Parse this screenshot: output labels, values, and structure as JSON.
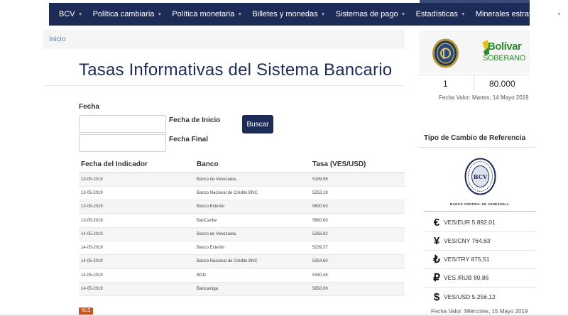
{
  "nav": {
    "items": [
      {
        "label": "BCV"
      },
      {
        "label": "Política cambiaria"
      },
      {
        "label": "Política monetaria"
      },
      {
        "label": "Billetes y monedas"
      },
      {
        "label": "Sistemas de pago"
      },
      {
        "label": "Estadísticas"
      },
      {
        "label": "Minerales estratégicos"
      }
    ]
  },
  "breadcrumb": {
    "home": "Inicio"
  },
  "page": {
    "title": "Tasas Informativas del Sistema Bancario"
  },
  "form": {
    "fecha_label": "Fecha",
    "start_label": "Fecha de Inicio",
    "end_label": "Fecha Final",
    "start_value": "",
    "end_value": "",
    "search_button": "Buscar"
  },
  "table": {
    "headers": [
      "Fecha del Indicador",
      "Banco",
      "Tasa (VES/USD)"
    ],
    "rows": [
      [
        "13-05-2019",
        "Banco de Venezuela",
        "5189.56"
      ],
      [
        "13-05-2019",
        "Banco Nacional de Crédito BNC",
        "5253.19"
      ],
      [
        "13-05-2019",
        "Banco Exterior",
        "5600.00"
      ],
      [
        "13-05-2019",
        "BanCaribe",
        "5860.00"
      ],
      [
        "14-05-2019",
        "Banco de Venezuela",
        "5256.82"
      ],
      [
        "14-05-2019",
        "Banco Exterior",
        "5239.37"
      ],
      [
        "14-05-2019",
        "Banco Nacional de Crédito BNC",
        "5254.60"
      ],
      [
        "14-05-2019",
        "BOD",
        "5340.45"
      ],
      [
        "14-05-2019",
        "Bancamiga",
        "5650.00"
      ]
    ],
    "export_label": "XLS"
  },
  "sidebar": {
    "bolivar_logo": {
      "line1": "Bolívar",
      "line2": "SOBERANO"
    },
    "petro_value": "1",
    "bs_value": "80.000",
    "petro_fecha": "Fecha Valor: Martes, 14 Mayo 2019",
    "ref_heading": "Tipo de Cambio de Referencia",
    "seal_caption": "BANCO CENTRAL DE VENEZUELA",
    "seal_initials": "BCV",
    "rates": [
      {
        "symbol": "€",
        "icon": "euro-icon",
        "text": "VES/EUR 5.892,01"
      },
      {
        "symbol": "¥",
        "icon": "yuan-icon",
        "text": "VES/CNY 764,63"
      },
      {
        "symbol": "₺",
        "icon": "lira-icon",
        "text": "VES/TRY 875,51"
      },
      {
        "symbol": "₽",
        "icon": "ruble-icon",
        "text": "VES /RUB 80,86"
      },
      {
        "symbol": "$",
        "icon": "dollar-icon",
        "text": "VES/USD 5.256,12"
      }
    ],
    "rates_fecha": "Fecha Valor: Miércoles, 15 Mayo 2019"
  },
  "colors": {
    "navy": "#1d2b57",
    "xls": "#c9541c",
    "bolivar_green": "#2e8b2e",
    "bolivar_yellow": "#e2c21a"
  }
}
